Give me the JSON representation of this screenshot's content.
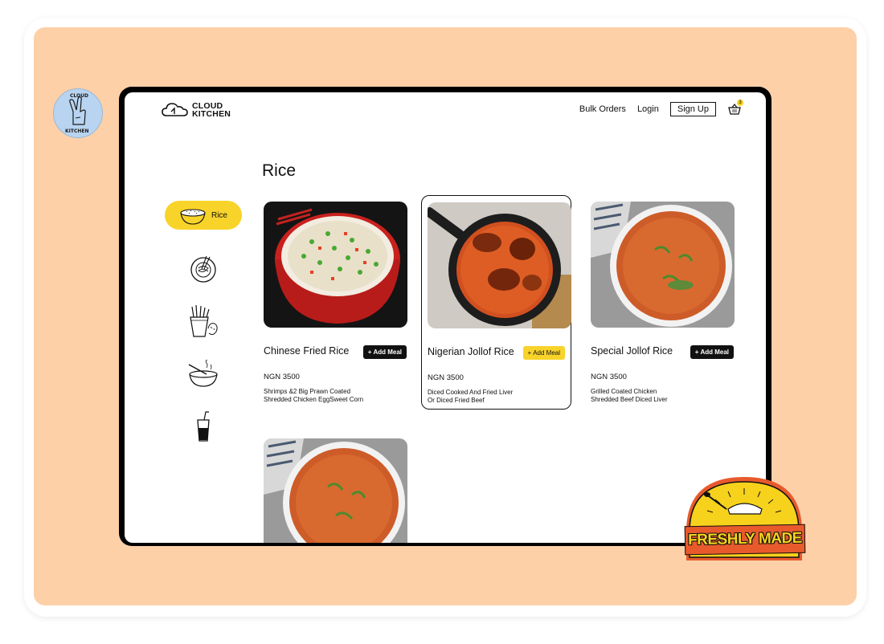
{
  "badge": {
    "text_top": "CLOUD",
    "text_bottom": "KITCHEN"
  },
  "header": {
    "logo_line1": "CLOUD",
    "logo_line2": "KITCHEN",
    "nav": {
      "bulk_orders": "Bulk Orders",
      "login": "Login",
      "signup": "Sign Up"
    },
    "cart_count": "3"
  },
  "page_title": "Rice",
  "sidebar": {
    "active_label": "Rice",
    "items": [
      {
        "name": "rice",
        "icon": "rice-bowl-icon"
      },
      {
        "name": "noodles",
        "icon": "noodle-plate-icon"
      },
      {
        "name": "sides",
        "icon": "fries-icon"
      },
      {
        "name": "soup",
        "icon": "soup-bowl-icon"
      },
      {
        "name": "drinks",
        "icon": "drink-cup-icon"
      }
    ]
  },
  "meals": [
    {
      "title": "Chinese Fried Rice",
      "button": "Add Meal",
      "price": "NGN 3500",
      "desc_line1": "Shrimps &2 Big Prawn Coated",
      "desc_line2": "Shredded Chicken EggSweet Corn"
    },
    {
      "title": "Nigerian Jollof Rice",
      "button": "Add Meal",
      "price": "NGN 3500",
      "desc_line1": "Diced Cooked And Fried Liver",
      "desc_line2": "Or Diced Fried Beef"
    },
    {
      "title": "Special Jollof Rice",
      "button": "Add Meal",
      "price": "NGN 3500",
      "desc_line1": "Grilled Coated Chicken",
      "desc_line2": "Shredded Beef Diced Liver"
    }
  ],
  "sticker": {
    "text": "FRESHLY MADE"
  },
  "colors": {
    "accent": "#f8d32a",
    "background": "#fdd0a8",
    "badge": "#b8d4f0"
  }
}
